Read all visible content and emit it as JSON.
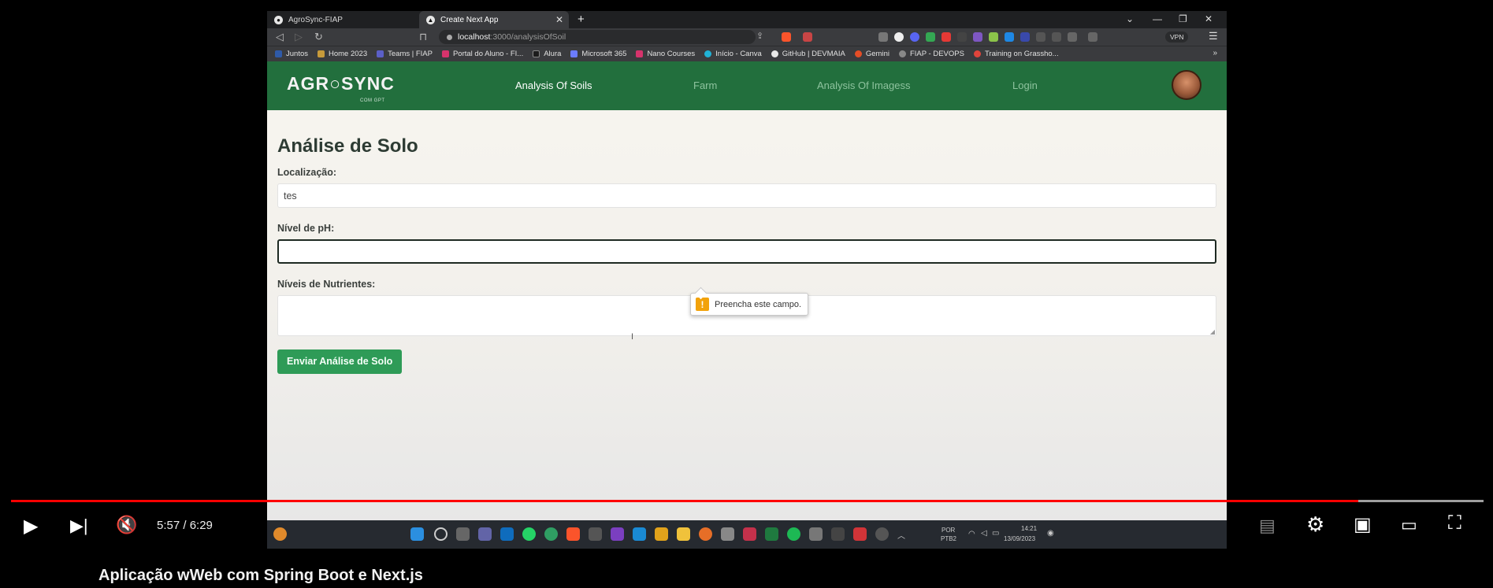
{
  "browser": {
    "tabs": [
      {
        "label": "AgroSync-FIAP",
        "active": false
      },
      {
        "label": "Create Next App",
        "active": true
      }
    ],
    "url_host": "localhost",
    "url_path": ":3000/analysisOfSoil",
    "vpn_label": "VPN",
    "bookmarks": [
      {
        "label": "Juntos",
        "color": "#2f5aa8"
      },
      {
        "label": "Home 2023",
        "color": "#c79a3a"
      },
      {
        "label": "Teams | FIAP",
        "color": "#5b5fc7"
      },
      {
        "label": "Portal do Aluno - FI...",
        "color": "#d6336c"
      },
      {
        "label": "Alura",
        "color": "#1c1c1c"
      },
      {
        "label": "Microsoft 365",
        "color": "#6b7cff"
      },
      {
        "label": "Nano Courses",
        "color": "#d6336c"
      },
      {
        "label": "Início - Canva",
        "color": "#20b2d6"
      },
      {
        "label": "GitHub | DEVMAIA",
        "color": "#e8e8e8"
      },
      {
        "label": "Gemini",
        "color": "#e44d26"
      },
      {
        "label": "FIAP - DEVOPS",
        "color": "#888888"
      },
      {
        "label": "Training on Grassho...",
        "color": "#e0443b"
      }
    ]
  },
  "site": {
    "logo_text": "AGR○SYNC",
    "logo_sub": "COM GPT",
    "nav": [
      {
        "label": "Analysis Of Soils",
        "active": true
      },
      {
        "label": "Farm",
        "active": false
      },
      {
        "label": "Analysis Of Imagess",
        "active": false
      },
      {
        "label": "Login",
        "active": false
      }
    ],
    "form": {
      "title": "Análise de Solo",
      "location_label": "Localização:",
      "location_value": "tes",
      "ph_label": "Nível de pH:",
      "ph_value": "",
      "nutrients_label": "Níveis de Nutrientes:",
      "nutrients_value": "",
      "submit_label": "Enviar Análise de Solo",
      "validation_message": "Preencha este campo."
    }
  },
  "taskbar": {
    "lang_line1": "POR",
    "lang_line2": "PTB2",
    "time": "14:21",
    "date": "13/09/2023"
  },
  "player": {
    "time_display": "5:57 / 6:29",
    "progress_fraction": 0.915,
    "buffered_fraction": 1.0,
    "video_title": "Aplicação wWeb com Spring Boot e Next.js",
    "accent_color": "#ff0000"
  }
}
